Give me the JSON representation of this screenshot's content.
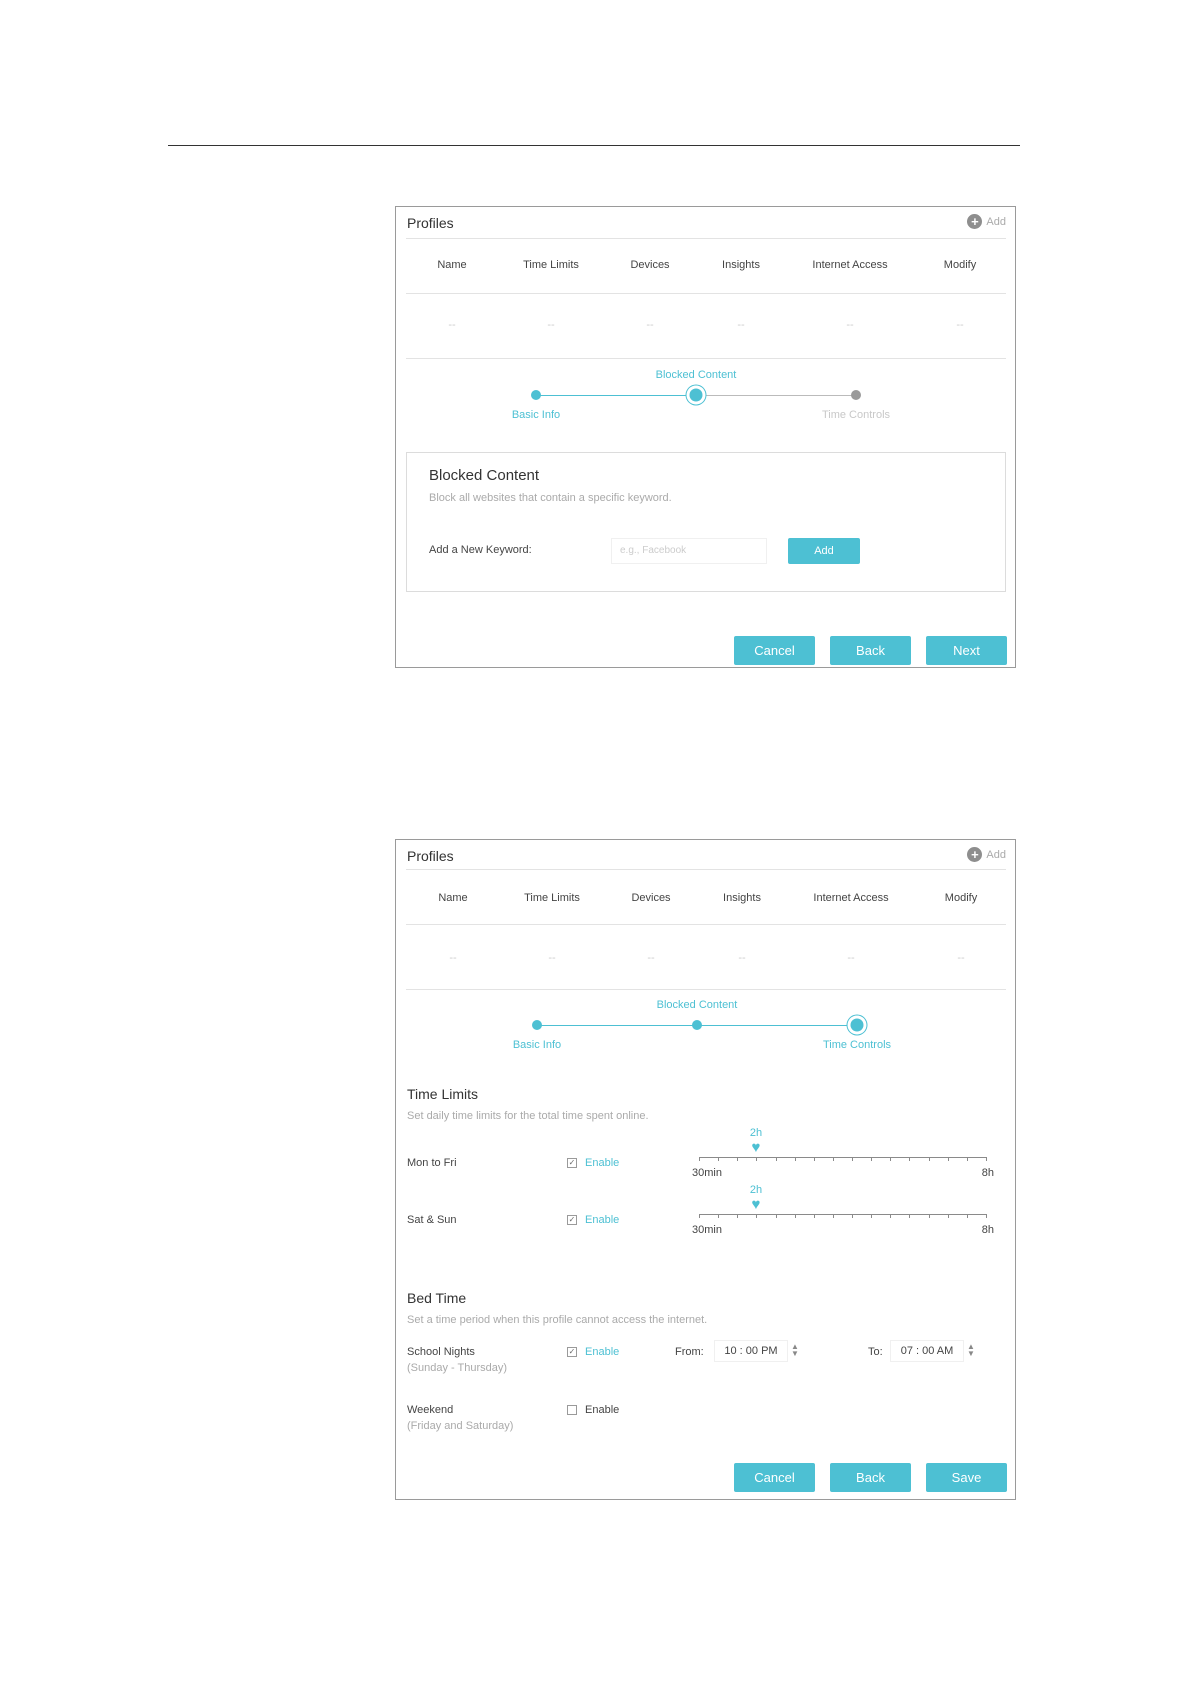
{
  "profiles": {
    "title": "Profiles",
    "add_label": "Add",
    "columns": [
      "Name",
      "Time Limits",
      "Devices",
      "Insights",
      "Internet Access",
      "Modify"
    ],
    "empty_row_p1": [
      "--",
      "--",
      "--",
      "--",
      "--",
      "--"
    ],
    "empty_row_p2": [
      "--",
      "--",
      "--",
      "--",
      "--",
      "--"
    ]
  },
  "steps": {
    "basic_info": "Basic Info",
    "blocked_content": "Blocked Content",
    "time_controls": "Time Controls"
  },
  "panel1": {
    "section_title": "Blocked Content",
    "section_desc": "Block all websites that contain a specific keyword.",
    "keyword_label": "Add a New Keyword:",
    "keyword_placeholder": "e.g., Facebook",
    "add_button": "Add",
    "buttons": {
      "cancel": "Cancel",
      "back": "Back",
      "next": "Next"
    }
  },
  "panel2": {
    "time_limits": {
      "title": "Time Limits",
      "desc": "Set daily time limits for the total time spent online.",
      "rows": [
        {
          "label": "Mon to Fri",
          "enable_label": "Enable",
          "enabled": true,
          "value_label": "2h",
          "min": "30min",
          "max": "8h",
          "fraction": 0.2
        },
        {
          "label": "Sat & Sun",
          "enable_label": "Enable",
          "enabled": true,
          "value_label": "2h",
          "min": "30min",
          "max": "8h",
          "fraction": 0.2
        }
      ]
    },
    "bed_time": {
      "title": "Bed Time",
      "desc": "Set a time period when this profile cannot access the internet.",
      "school_nights": {
        "label": "School Nights",
        "sub": "(Sunday - Thursday)",
        "enable_label": "Enable",
        "enabled": true,
        "from_label": "From:",
        "from_value": "10 : 00  PM",
        "to_label": "To:",
        "to_value": "07 : 00  AM"
      },
      "weekend": {
        "label": "Weekend",
        "sub": "(Friday and Saturday)",
        "enable_label": "Enable",
        "enabled": false
      }
    },
    "buttons": {
      "cancel": "Cancel",
      "back": "Back",
      "save": "Save"
    }
  },
  "colors": {
    "accent": "#4dc0d3",
    "inactive": "#9a9a9a"
  }
}
